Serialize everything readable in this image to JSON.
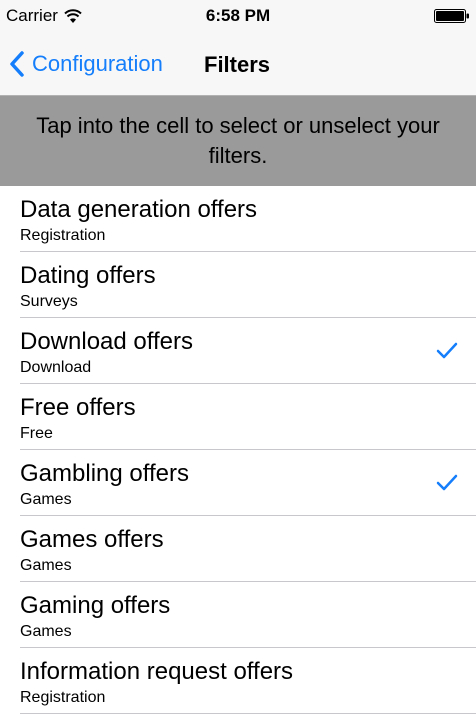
{
  "status_bar": {
    "carrier": "Carrier",
    "time": "6:58 PM"
  },
  "nav": {
    "back_label": "Configuration",
    "title": "Filters"
  },
  "hint": {
    "text": "Tap into the cell to select or unselect your filters."
  },
  "filters": [
    {
      "title": "Data generation offers",
      "subtitle": "Registration",
      "selected": false
    },
    {
      "title": "Dating offers",
      "subtitle": "Surveys",
      "selected": false
    },
    {
      "title": "Download offers",
      "subtitle": "Download",
      "selected": true
    },
    {
      "title": "Free offers",
      "subtitle": "Free",
      "selected": false
    },
    {
      "title": "Gambling offers",
      "subtitle": "Games",
      "selected": true
    },
    {
      "title": "Games offers",
      "subtitle": "Games",
      "selected": false
    },
    {
      "title": "Gaming offers",
      "subtitle": "Games",
      "selected": false
    },
    {
      "title": "Information request offers",
      "subtitle": "Registration",
      "selected": false
    }
  ],
  "colors": {
    "accent": "#147efb",
    "banner": "#9a9a9a",
    "bar": "#f7f7f7"
  },
  "icons": {
    "wifi": "wifi-icon",
    "battery": "battery-icon",
    "back": "chevron-left-icon",
    "check": "checkmark-icon"
  }
}
